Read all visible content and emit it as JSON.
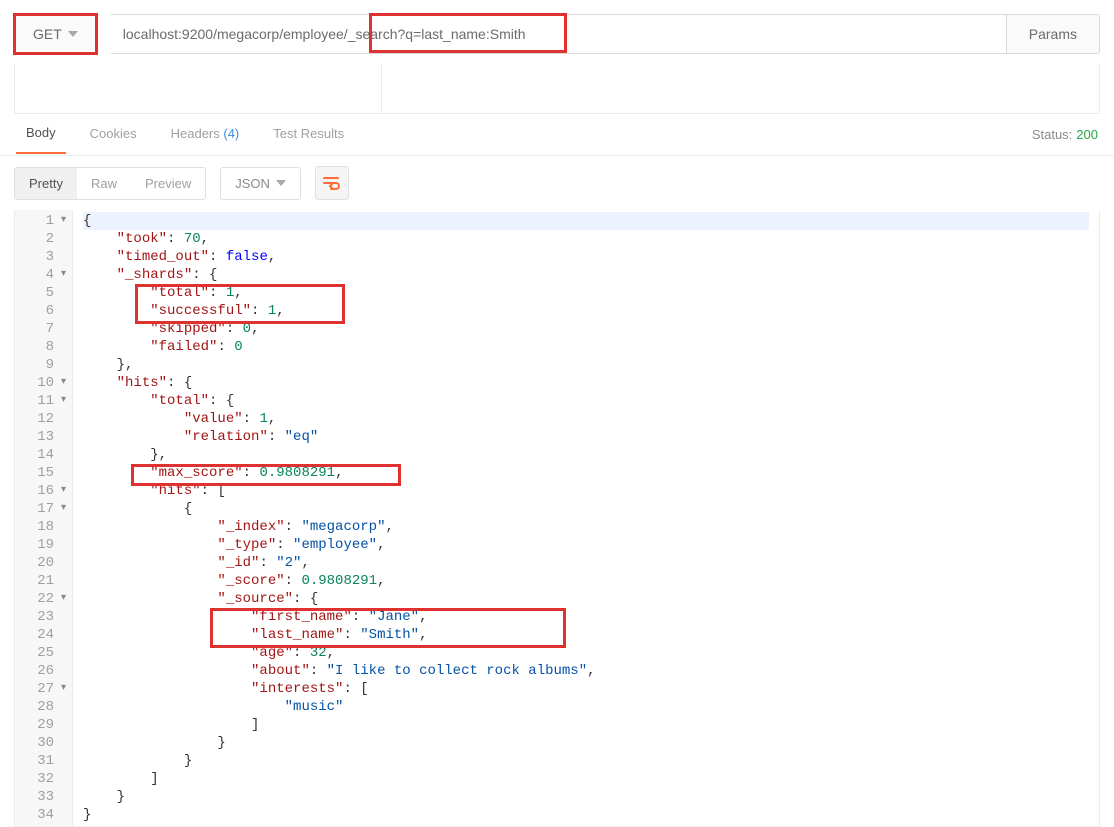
{
  "request": {
    "method": "GET",
    "url": "localhost:9200/megacorp/employee/_search?q=last_name:Smith",
    "params_button": "Params"
  },
  "tabs": {
    "body": "Body",
    "cookies": "Cookies",
    "headers": "Headers",
    "headers_count": "(4)",
    "test_results": "Test Results"
  },
  "status": {
    "label": "Status:",
    "code": "200"
  },
  "toolbar": {
    "pretty": "Pretty",
    "raw": "Raw",
    "preview": "Preview",
    "format": "JSON"
  },
  "response": {
    "took": 70,
    "timed_out": false,
    "_shards": {
      "total": 1,
      "successful": 1,
      "skipped": 0,
      "failed": 0
    },
    "hits": {
      "total": {
        "value": 1,
        "relation": "eq"
      },
      "max_score": 0.9808291,
      "hits": [
        {
          "_index": "megacorp",
          "_type": "employee",
          "_id": "2",
          "_score": 0.9808291,
          "_source": {
            "first_name": "Jane",
            "last_name": "Smith",
            "age": 32,
            "about": "I like to collect rock albums",
            "interests": [
              "music"
            ]
          }
        }
      ]
    }
  }
}
